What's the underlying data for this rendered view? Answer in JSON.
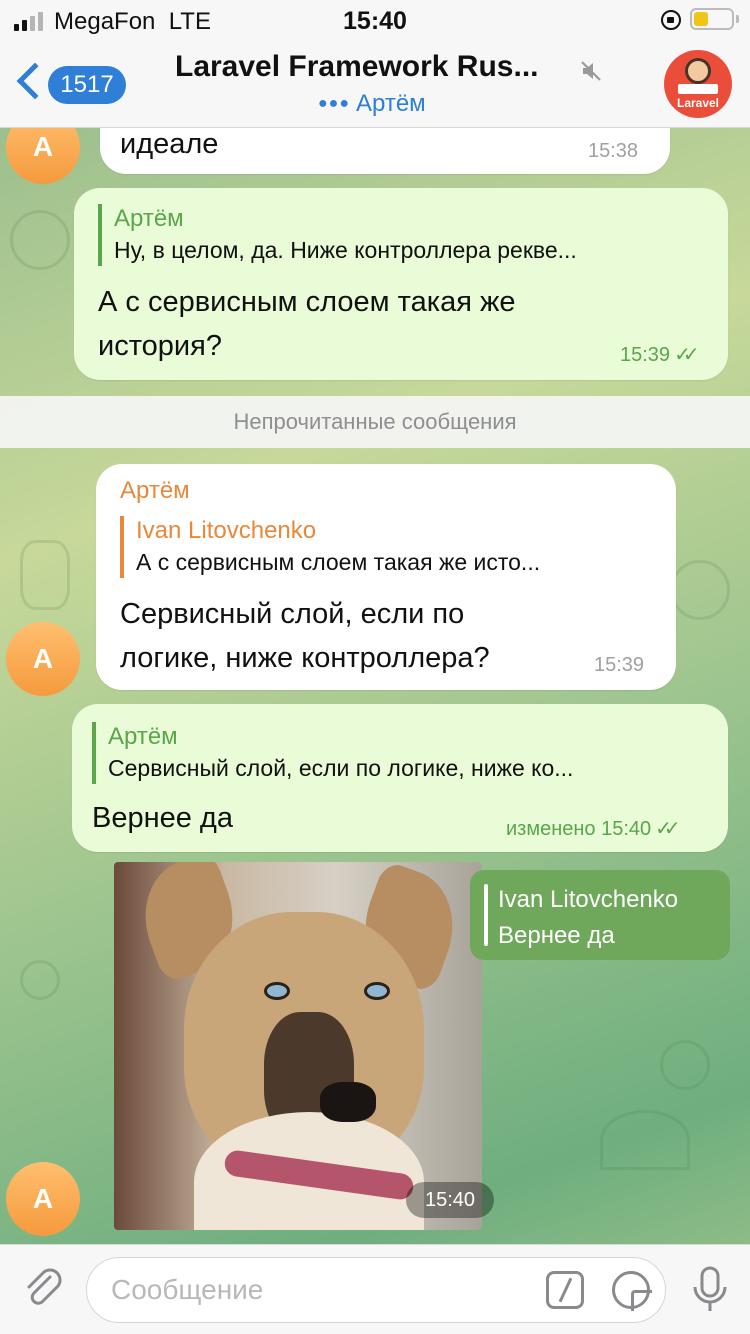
{
  "status_bar": {
    "carrier": "MegaFon",
    "network": "LTE",
    "time": "15:40",
    "battery_level": 0.4
  },
  "header": {
    "back_badge": "1517",
    "title": "Laravel Framework Rus...",
    "typing": "Артём",
    "channel_logo_text": "Laravel"
  },
  "messages": {
    "m1": {
      "text": "идеале",
      "time": "15:38",
      "avatar_letter": "А"
    },
    "m2": {
      "reply_name": "Артём",
      "reply_text": "Ну, в целом, да. Ниже контроллера рекве...",
      "text_line1": "А с сервисным слоем такая же",
      "text_line2": "история?",
      "time": "15:39"
    },
    "unread_divider": "Непрочитанные сообщения",
    "m3": {
      "sender": "Артём",
      "reply_name": "Ivan Litovchenko",
      "reply_text": "А с сервисным слоем такая же исто...",
      "text_line1": "Сервисный слой, если по",
      "text_line2": "логике, ниже контроллера?",
      "time": "15:39",
      "avatar_letter": "А"
    },
    "m4": {
      "reply_name": "Артём",
      "reply_text": "Сервисный слой, если по логике, ниже ко...",
      "text": "Вернее да",
      "edited_time": "изменено 15:40"
    },
    "m5": {
      "reply_name": "Ivan Litovchenko",
      "reply_text": "Вернее да",
      "time": "15:40",
      "avatar_letter": "А"
    }
  },
  "input": {
    "placeholder": "Сообщение"
  },
  "colors": {
    "accent": "#2f7fd8",
    "in_sender": "#e8883a",
    "out_reply": "#5aa64a",
    "out_bubble": "#eafbd7",
    "avatar": "#f59a3d"
  }
}
